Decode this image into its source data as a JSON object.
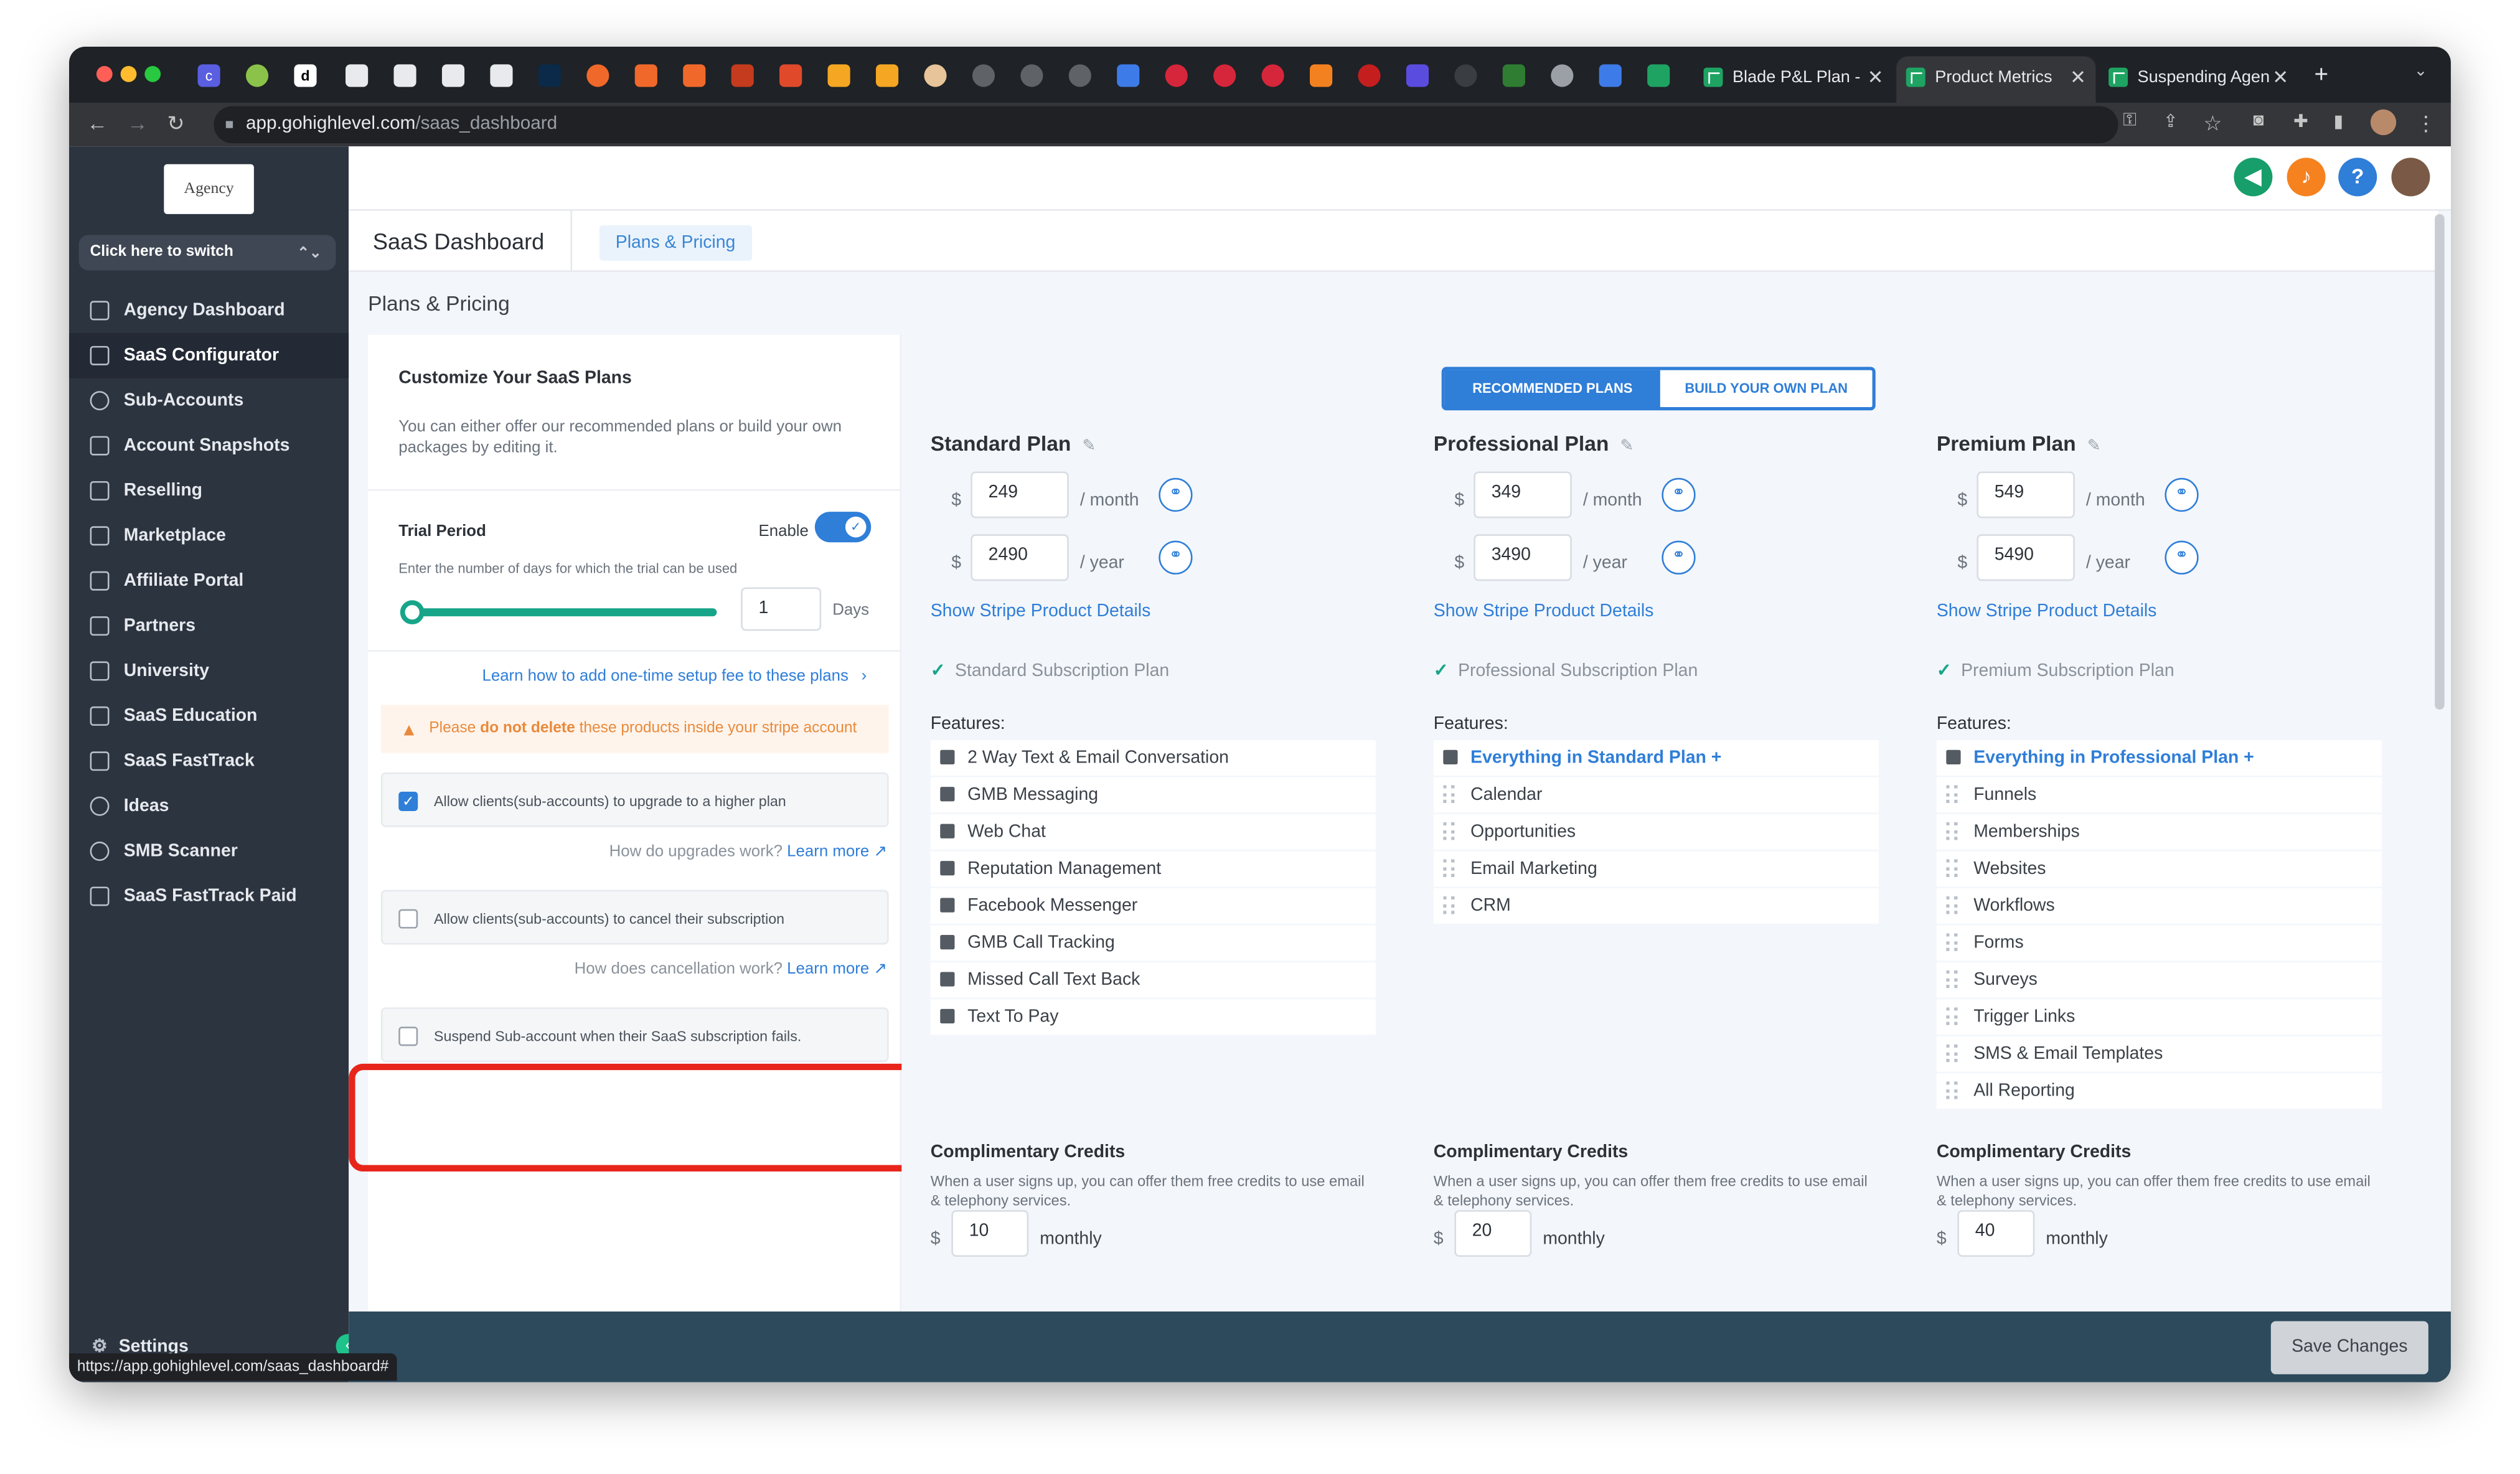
{
  "browser": {
    "url_host": "app.gohighlevel.com",
    "url_path": "/saas_dashboard",
    "tabs": [
      {
        "title": "Blade P&L Plan -"
      },
      {
        "title": "Product Metrics"
      },
      {
        "title": "Suspending Agen"
      }
    ],
    "status_url": "https://app.gohighlevel.com/saas_dashboard#"
  },
  "sidebar": {
    "logo_text": "Agency",
    "switch_label": "Click here to switch",
    "items": [
      {
        "label": "Agency Dashboard"
      },
      {
        "label": "SaaS Configurator"
      },
      {
        "label": "Sub-Accounts"
      },
      {
        "label": "Account Snapshots"
      },
      {
        "label": "Reselling"
      },
      {
        "label": "Marketplace"
      },
      {
        "label": "Affiliate Portal"
      },
      {
        "label": "Partners"
      },
      {
        "label": "University"
      },
      {
        "label": "SaaS Education"
      },
      {
        "label": "SaaS FastTrack"
      },
      {
        "label": "Ideas"
      },
      {
        "label": "SMB Scanner"
      },
      {
        "label": "SaaS FastTrack Paid"
      }
    ],
    "settings_label": "Settings"
  },
  "header": {
    "title": "SaaS Dashboard",
    "chip": "Plans & Pricing",
    "breadcrumb": "Plans & Pricing",
    "help_icon": "?"
  },
  "left": {
    "title": "Customize Your SaaS Plans",
    "description": "You can either offer our recommended plans or build your own packages by editing it.",
    "trial_label": "Trial Period",
    "enable_label": "Enable",
    "trial_hint": "Enter the number of days for which the trial can be used",
    "trial_days": "1",
    "days_label": "Days",
    "setup_fee_link": "Learn how to add one-time setup fee to these plans",
    "warning_prefix": "Please",
    "warning_bold": "do not delete",
    "warning_suffix": "these products inside your stripe account",
    "upgrade_label": "Allow clients(sub-accounts) to upgrade to a higher plan",
    "upgrade_help": "How do upgrades work?",
    "learn_more": "Learn more",
    "cancel_label": "Allow clients(sub-accounts) to cancel their subscription",
    "cancel_help": "How does cancellation work?",
    "suspend_label": "Suspend Sub-account when their SaaS subscription fails."
  },
  "plans_toggle": {
    "recommended": "RECOMMENDED PLANS",
    "build": "BUILD YOUR OWN PLAN"
  },
  "labels": {
    "per_month": "/ month",
    "per_year": "/ year",
    "currency": "$",
    "stripe_link": "Show Stripe Product Details",
    "features": "Features:",
    "credits_title": "Complimentary Credits",
    "credits_desc": "When a user signs up, you can offer them free credits to use email & telephony services.",
    "monthly": "monthly"
  },
  "plans": [
    {
      "name": "Standard Plan",
      "monthly": "249",
      "yearly": "2490",
      "subscription": "Standard Subscription Plan",
      "features": [
        "2 Way Text & Email Conversation",
        "GMB Messaging",
        "Web Chat",
        "Reputation Management",
        "Facebook Messenger",
        "GMB Call Tracking",
        "Missed Call Text Back",
        "Text To Pay"
      ],
      "credits": "10"
    },
    {
      "name": "Professional Plan",
      "monthly": "349",
      "yearly": "3490",
      "subscription": "Professional Subscription Plan",
      "features": [
        "Everything in Standard Plan +",
        "Calendar",
        "Opportunities",
        "Email Marketing",
        "CRM"
      ],
      "credits": "20"
    },
    {
      "name": "Premium Plan",
      "monthly": "549",
      "yearly": "5490",
      "subscription": "Premium Subscription Plan",
      "features": [
        "Everything in Professional Plan +",
        "Funnels",
        "Memberships",
        "Websites",
        "Workflows",
        "Forms",
        "Surveys",
        "Trigger Links",
        "SMS & Email Templates",
        "All Reporting"
      ],
      "credits": "40"
    }
  ],
  "footer": {
    "save_label": "Save Changes"
  },
  "colors": {
    "sidebar": "#2c3440",
    "accent": "#2f7ed8",
    "highlight_box": "#e8251b",
    "footer": "#2d4a5c"
  }
}
